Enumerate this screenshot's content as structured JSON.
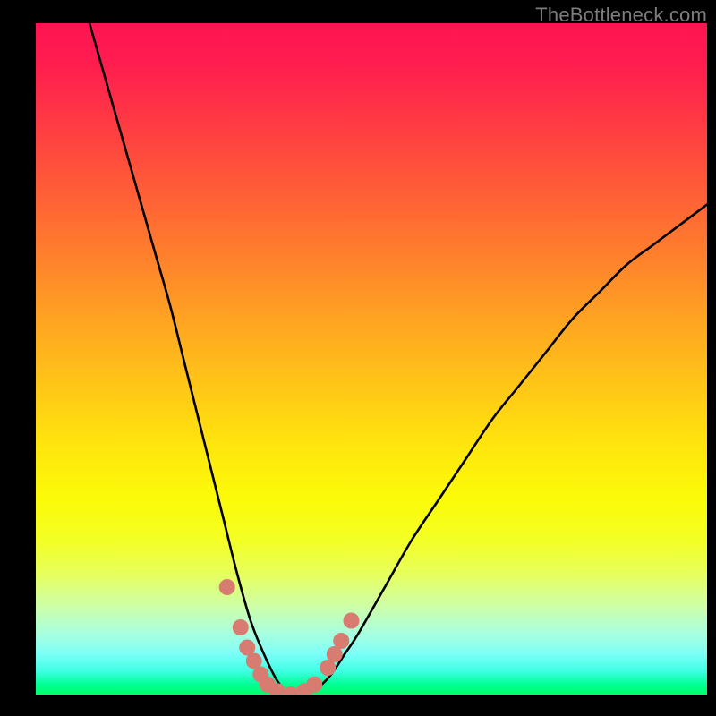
{
  "watermark": "TheBottleneck.com",
  "chart_data": {
    "type": "line",
    "title": "",
    "xlabel": "",
    "ylabel": "",
    "xlim": [
      0,
      100
    ],
    "ylim": [
      0,
      100
    ],
    "grid": false,
    "background": "rainbow-vertical-gradient",
    "curve_minimum_x": 37,
    "series": [
      {
        "name": "bottleneck-curve",
        "color": "#000000",
        "x": [
          8,
          10,
          12,
          14,
          16,
          18,
          20,
          22,
          24,
          26,
          28,
          30,
          32,
          34,
          36,
          38,
          40,
          42,
          44,
          46,
          48,
          52,
          56,
          60,
          64,
          68,
          72,
          76,
          80,
          84,
          88,
          92,
          96,
          100
        ],
        "y": [
          100,
          93,
          86,
          79,
          72,
          65,
          58,
          50,
          42,
          34,
          26,
          18,
          11,
          6,
          2,
          0,
          0,
          1,
          3,
          6,
          9,
          16,
          23,
          29,
          35,
          41,
          46,
          51,
          56,
          60,
          64,
          67,
          70,
          73
        ]
      }
    ],
    "markers": {
      "name": "highlight-dots",
      "color": "#d87b70",
      "points": [
        {
          "x": 28.5,
          "y": 16
        },
        {
          "x": 30.5,
          "y": 10
        },
        {
          "x": 31.5,
          "y": 7
        },
        {
          "x": 32.5,
          "y": 5
        },
        {
          "x": 33.5,
          "y": 3
        },
        {
          "x": 34.5,
          "y": 1.5
        },
        {
          "x": 36.0,
          "y": 0.5
        },
        {
          "x": 38.0,
          "y": 0
        },
        {
          "x": 40.0,
          "y": 0.5
        },
        {
          "x": 41.5,
          "y": 1.5
        },
        {
          "x": 43.5,
          "y": 4
        },
        {
          "x": 44.5,
          "y": 6
        },
        {
          "x": 45.5,
          "y": 8
        },
        {
          "x": 47.0,
          "y": 11
        }
      ]
    }
  }
}
